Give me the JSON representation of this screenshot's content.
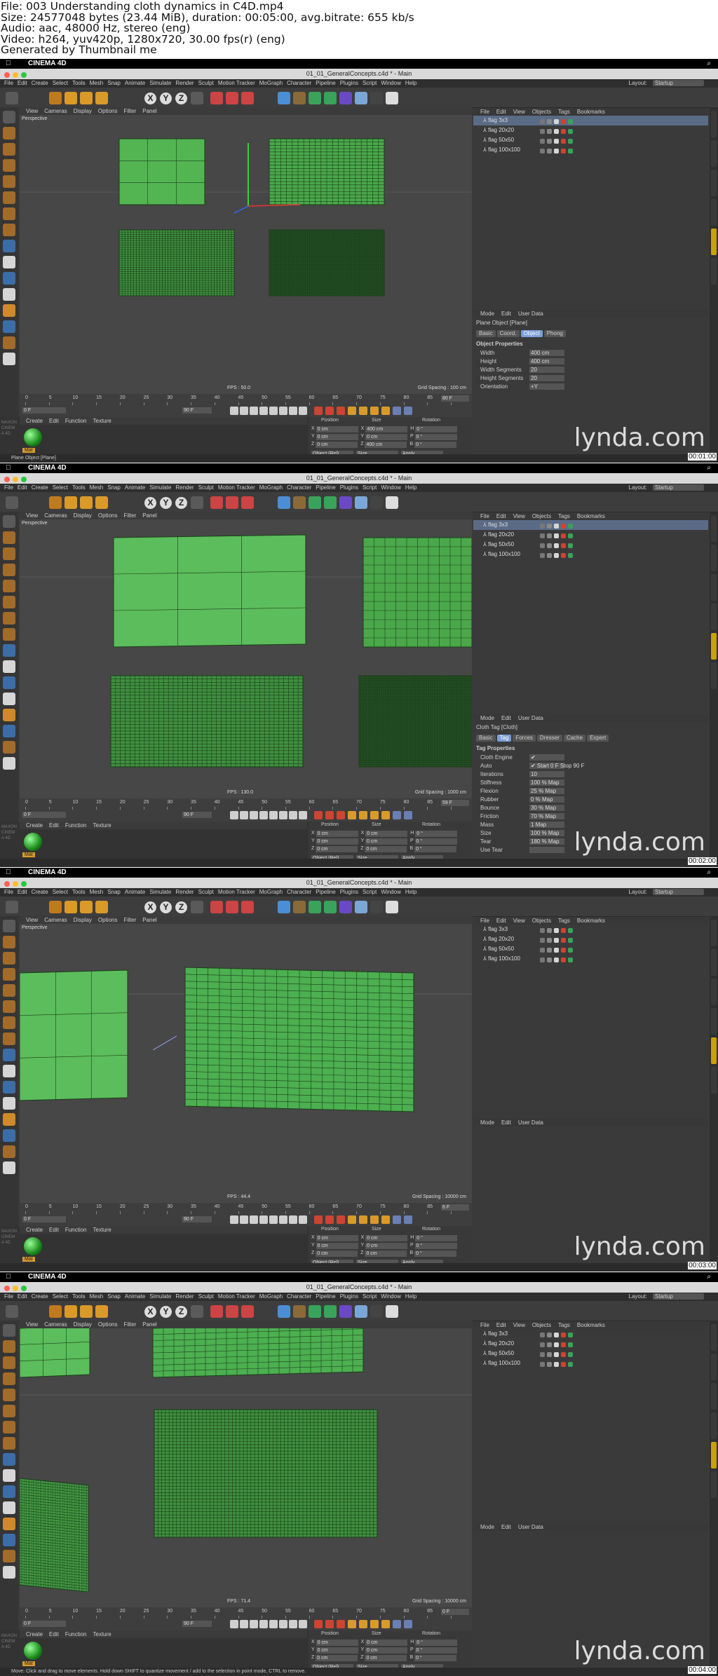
{
  "header": {
    "file": "File: 003 Understanding cloth dynamics in C4D.mp4",
    "size": "Size: 24577048 bytes (23.44 MiB), duration: 00:05:00, avg.bitrate: 655 kb/s",
    "audio": "Audio: aac, 48000 Hz, stereo (eng)",
    "video": "Video: h264, yuv420p, 1280x720, 30.00 fps(r) (eng)",
    "generated": "Generated by Thumbnail me"
  },
  "app": {
    "mac_app_name": "CINEMA 4D",
    "window_title": "01_01_GeneralConcepts.c4d * - Main",
    "menus": [
      "File",
      "Edit",
      "Create",
      "Select",
      "Tools",
      "Mesh",
      "Snap",
      "Animate",
      "Simulate",
      "Render",
      "Sculpt",
      "Motion Tracker",
      "MoGraph",
      "Character",
      "Pipeline",
      "Plugins",
      "Script",
      "Window",
      "Help"
    ],
    "layout_label": "Layout:",
    "layout_value": "Startup",
    "viewport_menus": [
      "View",
      "Cameras",
      "Display",
      "Options",
      "Filter",
      "Panel"
    ],
    "viewport_label": "Perspective",
    "objmgr_menus": [
      "File",
      "Edit",
      "View",
      "Objects",
      "Tags",
      "Bookmarks"
    ],
    "objects": [
      "flag 3x3",
      "flag 20x20",
      "flag 50x50",
      "flag 100x100"
    ],
    "attr_menus": [
      "Mode",
      "Edit",
      "User Data"
    ],
    "mat_menus": [
      "Create",
      "Edit",
      "Function",
      "Texture"
    ],
    "mat_label": "Mat",
    "coord_headers": [
      "Position",
      "Size",
      "Rotation"
    ],
    "coord_dropdowns": [
      "Object (Rel)",
      "Size"
    ],
    "apply_label": "Apply",
    "ruler_ticks": [
      "0",
      "5",
      "10",
      "15",
      "20",
      "25",
      "30",
      "35",
      "40",
      "45",
      "50",
      "55",
      "60",
      "65",
      "70",
      "75",
      "80",
      "85",
      "90"
    ],
    "side_tabs": [
      "Attributes",
      "Layers"
    ],
    "left_right_tabs": [
      "Objects",
      "Takes",
      "Content Browser",
      "Structure"
    ],
    "watermark": "lynda.com",
    "colors": {
      "viewport_bg": "#474747",
      "flag_green": "#4caf50",
      "wire": "#1f4d1f",
      "ui_dark": "#3a3a3a"
    }
  },
  "frames": [
    {
      "timestamp": "00:01:00",
      "selected_object_index": 0,
      "fps_label": "FPS : 50.0",
      "grid_label": "Grid Spacing : 100 cm",
      "current_frame": "0 F",
      "end_frame": "90 F",
      "frame_readout": "80 F",
      "attr_title": "Plane Object [Plane]",
      "attr_tabs": [
        "Basic",
        "Coord.",
        "Object",
        "Phong"
      ],
      "attr_tab_active": 2,
      "attr_section": "Object Properties",
      "props": [
        {
          "label": "Width",
          "value": "400 cm"
        },
        {
          "label": "Height",
          "value": "400 cm"
        },
        {
          "label": "Width Segments",
          "value": "20"
        },
        {
          "label": "Height Segments",
          "value": "20"
        },
        {
          "label": "Orientation",
          "value": "+Y"
        }
      ],
      "coords": [
        [
          "X",
          "0 cm",
          "X",
          "400 cm",
          "H",
          "0 °"
        ],
        [
          "Y",
          "0 cm",
          "Y",
          "0 cm",
          "P",
          "0 °"
        ],
        [
          "Z",
          "0 cm",
          "Z",
          "400 cm",
          "B",
          "0 °"
        ]
      ],
      "status": "Plane Object [Plane]"
    },
    {
      "timestamp": "00:02:00",
      "selected_object_index": 0,
      "fps_label": "FPS : 130.0",
      "grid_label": "Grid Spacing : 1000 cm",
      "current_frame": "0 F",
      "end_frame": "90 F",
      "frame_readout": "59 F",
      "attr_title": "Cloth Tag [Cloth]",
      "attr_tabs": [
        "Basic",
        "Tag",
        "Forces",
        "Dresser",
        "Cache",
        "Expert"
      ],
      "attr_tab_active": 1,
      "attr_section": "Tag Properties",
      "props": [
        {
          "label": "Cloth Engine",
          "value": "✔"
        },
        {
          "label": "Auto",
          "value": "✔  Start  0 F   Stop  90 F"
        },
        {
          "label": "Iterations",
          "value": "10"
        },
        {
          "label": "Stiffness",
          "value": "100 %   Map"
        },
        {
          "label": "Flexion",
          "value": "25 %   Map"
        },
        {
          "label": "Rubber",
          "value": "0 %   Map"
        },
        {
          "label": "Bounce",
          "value": "30 %   Map"
        },
        {
          "label": "Friction",
          "value": "70 %   Map"
        },
        {
          "label": "Mass",
          "value": "1   Map"
        },
        {
          "label": "Size",
          "value": "100 %   Map"
        },
        {
          "label": "Tear",
          "value": "180 %   Map"
        },
        {
          "label": "Use Tear",
          "value": ""
        }
      ],
      "coords": [
        [
          "X",
          "0 cm",
          "X",
          "0 cm",
          "H",
          "0 °"
        ],
        [
          "Y",
          "0 cm",
          "Y",
          "0 cm",
          "P",
          "0 °"
        ],
        [
          "Z",
          "0 cm",
          "Z",
          "0 cm",
          "B",
          "0 °"
        ]
      ],
      "status": ""
    },
    {
      "timestamp": "00:03:00",
      "selected_object_index": -1,
      "fps_label": "FPS : 44.4",
      "grid_label": "Grid Spacing : 10000 cm",
      "current_frame": "0 F",
      "end_frame": "90 F",
      "frame_readout": "6 F",
      "attr_title": "",
      "attr_tabs": [],
      "attr_tab_active": -1,
      "attr_section": "",
      "props": [],
      "coords": [
        [
          "X",
          "0 cm",
          "X",
          "0 cm",
          "H",
          "0 °"
        ],
        [
          "Y",
          "0 cm",
          "Y",
          "0 cm",
          "P",
          "0 °"
        ],
        [
          "Z",
          "0 cm",
          "Z",
          "0 cm",
          "B",
          "0 °"
        ]
      ],
      "status": ""
    },
    {
      "timestamp": "00:04:00",
      "selected_object_index": -1,
      "fps_label": "FPS : 71.4",
      "grid_label": "Grid Spacing : 10000 cm",
      "current_frame": "0 F",
      "end_frame": "90 F",
      "frame_readout": "0 F",
      "attr_title": "",
      "attr_tabs": [],
      "attr_tab_active": -1,
      "attr_section": "",
      "props": [],
      "coords": [
        [
          "X",
          "0 cm",
          "X",
          "0 cm",
          "H",
          "0 °"
        ],
        [
          "Y",
          "0 cm",
          "Y",
          "0 cm",
          "P",
          "0 °"
        ],
        [
          "Z",
          "0 cm",
          "Z",
          "0 cm",
          "B",
          "0 °"
        ]
      ],
      "status": "Move: Click and drag to move elements. Hold down SHIFT to quantize movement / add to the selection in point mode, CTRL to remove."
    }
  ]
}
